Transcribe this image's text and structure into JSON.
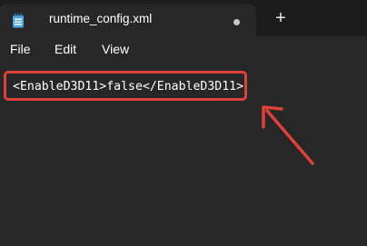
{
  "tab": {
    "title": "runtime_config.xml",
    "icon": "notepad-icon",
    "unsaved_indicator": "dot",
    "new_tab_label": "+"
  },
  "menu": {
    "items": [
      {
        "label": "File"
      },
      {
        "label": "Edit"
      },
      {
        "label": "View"
      }
    ]
  },
  "editor": {
    "lines": [
      "<EnableD3D11>false</EnableD3D11>"
    ]
  },
  "annotation": {
    "highlight_color": "#e0403a",
    "arrow_color": "#e0403a"
  },
  "colors": {
    "background": "#272727",
    "tabstrip": "#1c1c1c",
    "text": "#ffffff"
  }
}
